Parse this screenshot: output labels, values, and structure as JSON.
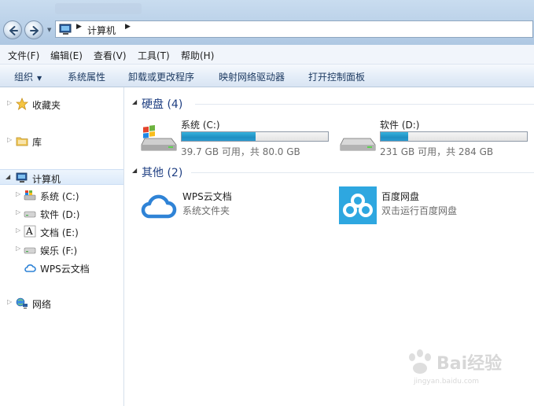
{
  "address": {
    "location": "计算机"
  },
  "menu": [
    "文件(F)",
    "编辑(E)",
    "查看(V)",
    "工具(T)",
    "帮助(H)"
  ],
  "commands": {
    "organize": "组织",
    "items": [
      "系统属性",
      "卸载或更改程序",
      "映射网络驱动器",
      "打开控制面板"
    ]
  },
  "nav": {
    "favorites": "收藏夹",
    "libraries": "库",
    "computer": "计算机",
    "drives": [
      "系统 (C:)",
      "软件 (D:)",
      "文档 (E:)",
      "娱乐 (F:)",
      "WPS云文档"
    ],
    "network": "网络"
  },
  "groups": {
    "hard_disks": {
      "title": "硬盘 (4)"
    },
    "other": {
      "title": "其他 (2)"
    }
  },
  "drives": [
    {
      "name": "系统 (C:)",
      "info": "39.7 GB 可用，共 80.0 GB",
      "used_fraction": 0.504
    },
    {
      "name": "软件 (D:)",
      "info": "231 GB 可用，共 284 GB",
      "used_fraction": 0.187
    }
  ],
  "apps": [
    {
      "name": "WPS云文档",
      "subtitle": "系统文件夹"
    },
    {
      "name": "百度网盘",
      "subtitle": "双击运行百度网盘"
    }
  ],
  "watermark": {
    "brand": "Bai经验",
    "url": "jingyan.baidu.com"
  },
  "colors": {
    "accent_blue": "#1f3f82",
    "bar_fill": "#2a9ad0",
    "baidu_blue": "#2ea7e0"
  }
}
